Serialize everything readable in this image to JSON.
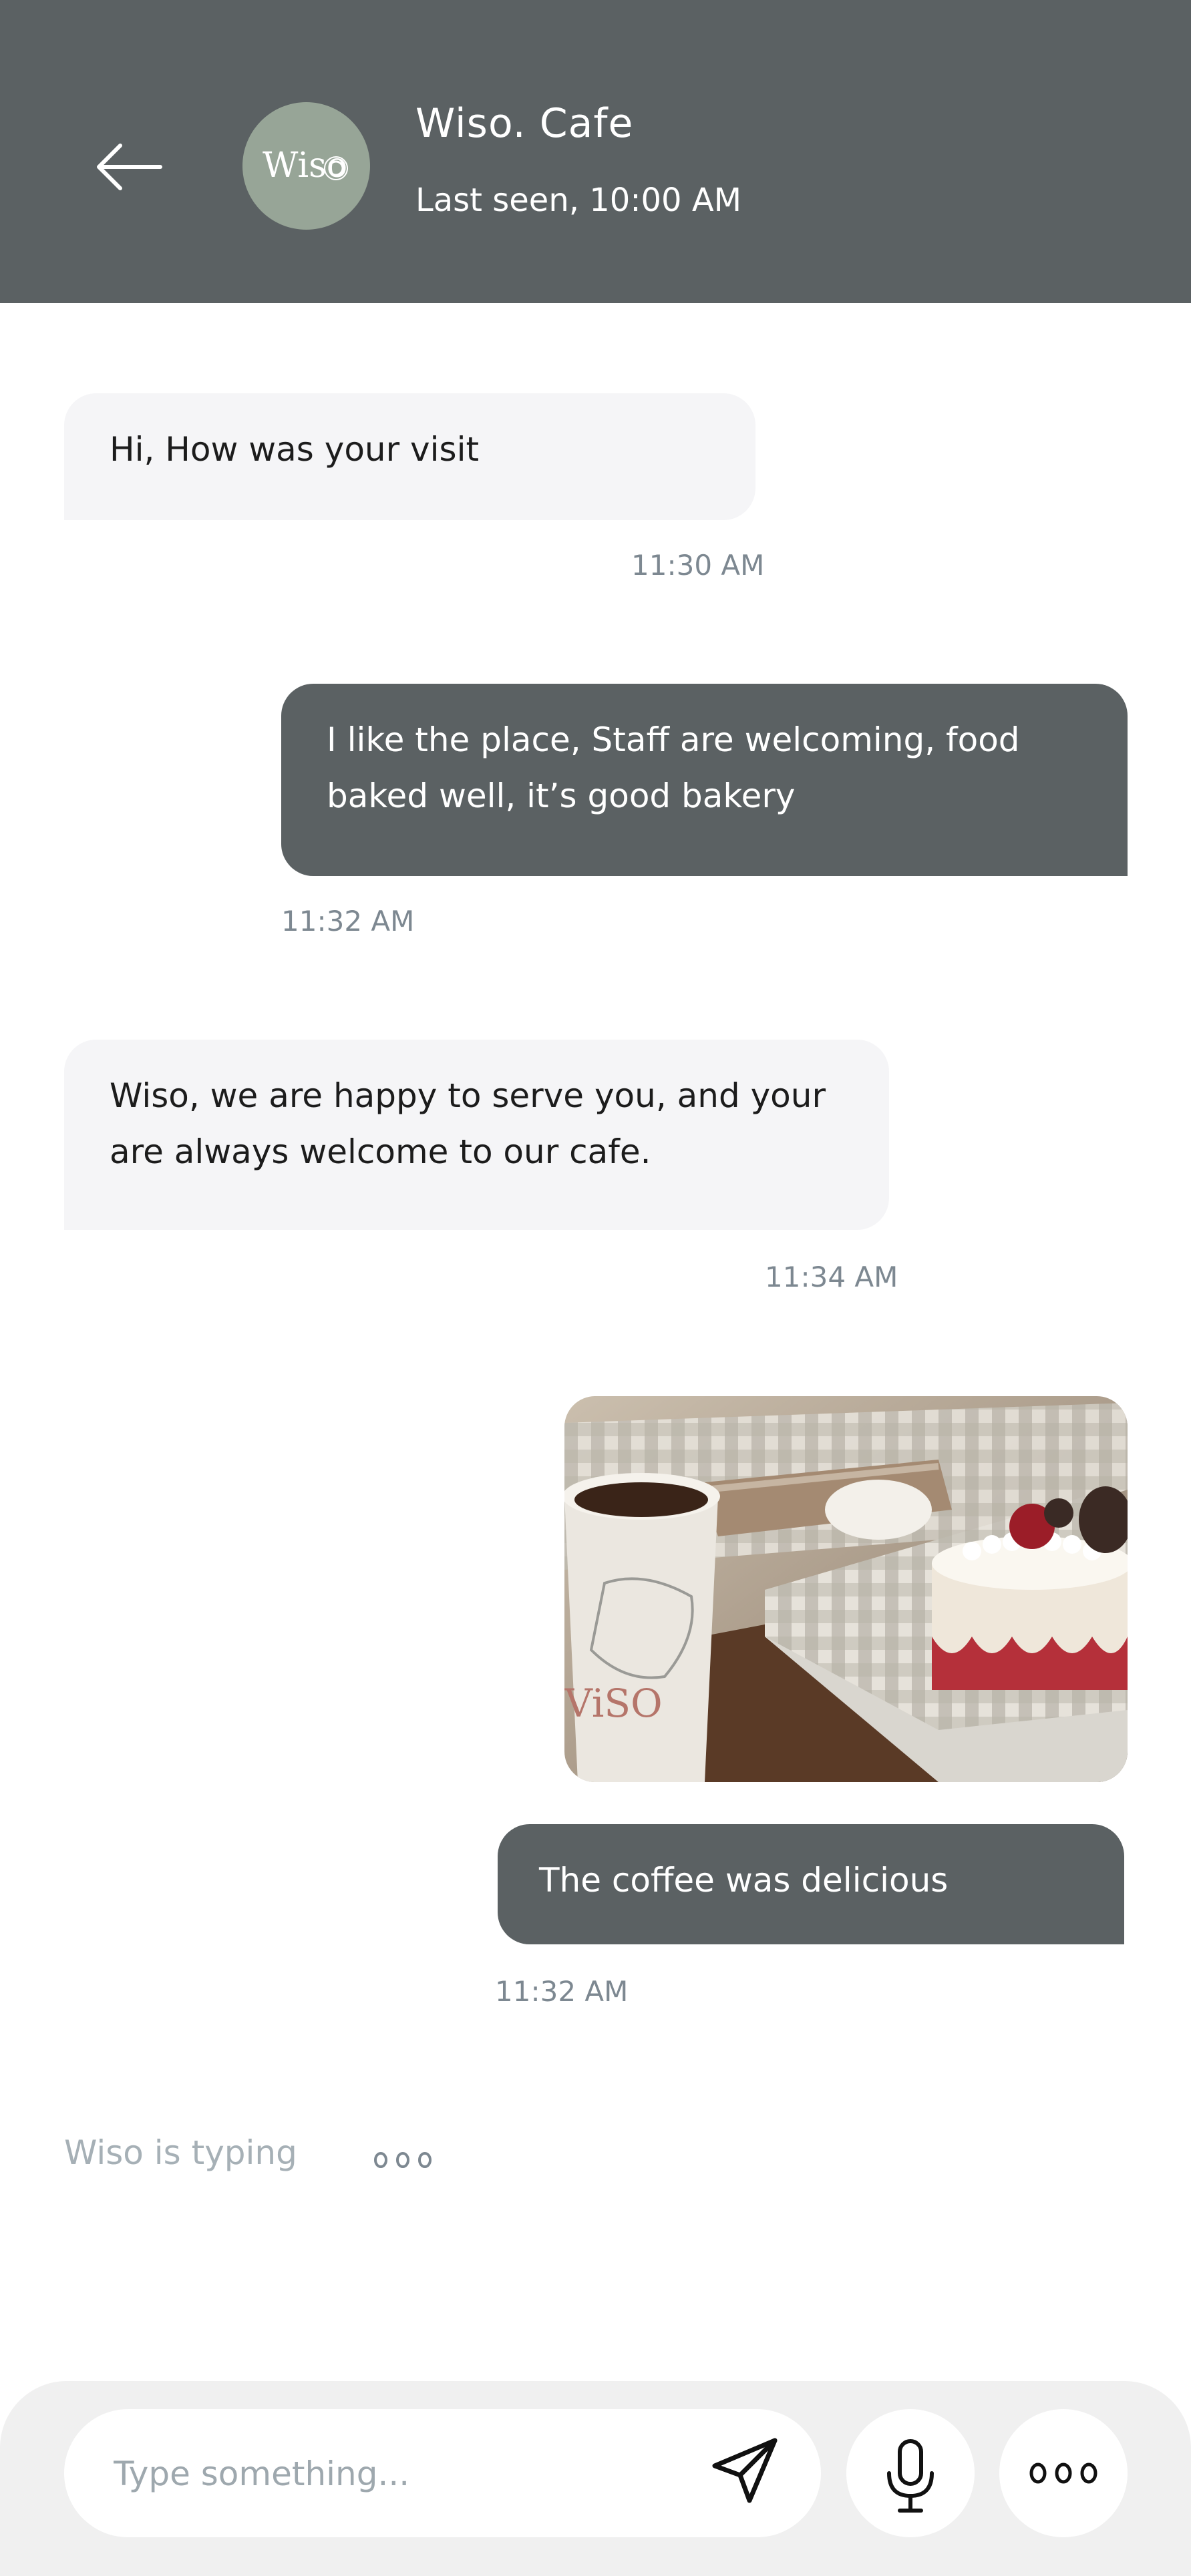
{
  "header": {
    "title": "Wiso. Cafe",
    "subtitle": "Last seen, 10:00 AM",
    "avatar_logo": "Wiso",
    "back_icon": "arrow-left-icon"
  },
  "messages": [
    {
      "direction": "incoming",
      "text": "Hi, How was your visit",
      "time": "11:30 AM"
    },
    {
      "direction": "outgoing",
      "text": "I like the place, Staff are welcoming, food baked well, it’s good bakery",
      "time": "11:32 AM"
    },
    {
      "direction": "incoming",
      "text": "Wiso, we are happy to serve you, and your are always welcome to our cafe.",
      "time": "11:34 AM"
    },
    {
      "direction": "outgoing",
      "image": "coffee-and-cake-photo",
      "text": "The coffee was delicious",
      "time": "11:32 AM"
    }
  ],
  "typing": {
    "text": "Wiso is typing",
    "icon": "typing-dots-icon"
  },
  "composer": {
    "placeholder": "Type something...",
    "send_icon": "send-icon",
    "mic_icon": "microphone-icon",
    "more_icon": "more-options-icon"
  },
  "colors": {
    "header": "#5b6163",
    "outgoing_bubble": "#5b6163",
    "incoming_bubble": "#f5f5f7",
    "timestamp": "#7d8891",
    "avatar": "#97a597",
    "bottom_bar": "#f0f0f0"
  }
}
